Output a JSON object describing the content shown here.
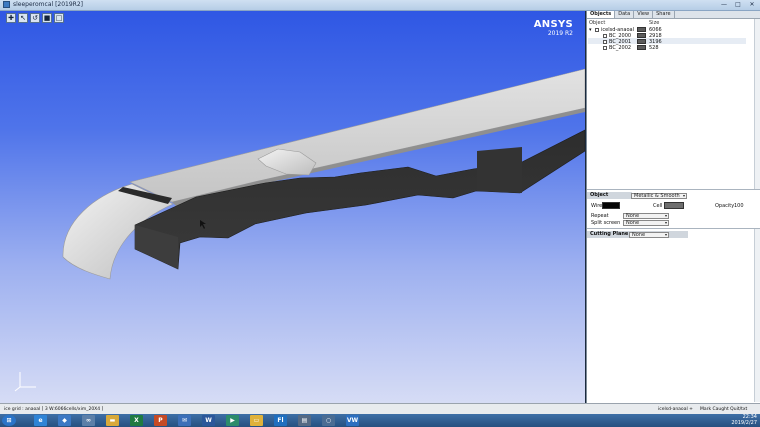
{
  "window": {
    "title": "sleeperomcal [2019R2]",
    "minimize": "—",
    "maximize": "□",
    "close": "✕"
  },
  "toolbar": {
    "buttons": [
      {
        "name": "select-mode-button",
        "glyph": "✚"
      },
      {
        "name": "pick-button",
        "glyph": "↖"
      },
      {
        "name": "rotate-button",
        "glyph": "↺"
      },
      {
        "name": "view-button",
        "glyph": "■"
      },
      {
        "name": "fit-button",
        "glyph": "□"
      }
    ]
  },
  "logo": {
    "brand": "ANSYS",
    "version": "2019 R2"
  },
  "panel": {
    "tabs": [
      "Objects",
      "Data",
      "View",
      "Share"
    ],
    "tree": {
      "col_object": "Object",
      "col_size": "Size",
      "items": [
        {
          "name": "icelsd-anaoal",
          "size": "6066",
          "level": 0
        },
        {
          "name": "BC_2000",
          "size": "2918",
          "level": 1
        },
        {
          "name": "BC_2001",
          "size": "3196",
          "level": 1
        },
        {
          "name": "BC_2002",
          "size": "528",
          "level": 1
        }
      ]
    },
    "object": {
      "header": "Object",
      "render_mode": "Metallic & Smooth",
      "wire_label": "Wire",
      "cell_label": "Cell",
      "opacity_label": "Opacity",
      "opacity_value": "100",
      "repeat_label": "Repeat",
      "repeat_value": "None",
      "split_label": "Split screen",
      "split_value": "None"
    },
    "cutting": {
      "header": "Cutting Plane",
      "value": "None"
    }
  },
  "status": {
    "left": "ice grid : anaoal [ 3 W:6066cells/xim_20X4 ]",
    "middle": "icelsd-anaoal +",
    "right": "Mark Caught Quit/txt"
  },
  "taskbar": {
    "clock_time": "22:34",
    "clock_date": "2019/2/27",
    "apps": [
      {
        "name": "ie-icon",
        "glyph": "e",
        "color": "#2f84d6"
      },
      {
        "name": "shield-icon",
        "glyph": "◆",
        "color": "#3b78c4"
      },
      {
        "name": "flow-icon",
        "glyph": "∞",
        "color": "#5c7fa8"
      },
      {
        "name": "explorer-icon",
        "glyph": "▬",
        "color": "#d8a93a"
      },
      {
        "name": "excel-icon",
        "glyph": "X",
        "color": "#1f7a41"
      },
      {
        "name": "powerpoint-icon",
        "glyph": "P",
        "color": "#c54a25"
      },
      {
        "name": "mail-icon",
        "glyph": "✉",
        "color": "#3c6fb8"
      },
      {
        "name": "word-icon",
        "glyph": "W",
        "color": "#2b579a"
      },
      {
        "name": "media-icon",
        "glyph": "▶",
        "color": "#2c8c6b"
      },
      {
        "name": "folder-icon",
        "glyph": "▭",
        "color": "#e0b23b"
      },
      {
        "name": "fluent-icon",
        "glyph": "Fl",
        "color": "#1f6fbf"
      },
      {
        "name": "terminal-icon",
        "glyph": "▤",
        "color": "#566a84"
      },
      {
        "name": "search-icon",
        "glyph": "○",
        "color": "#4a6c93"
      },
      {
        "name": "vw-icon",
        "glyph": "VW",
        "color": "#2d6fc0"
      }
    ]
  },
  "colors": {
    "wire": "#050505",
    "cell": "#6e6e6e"
  }
}
